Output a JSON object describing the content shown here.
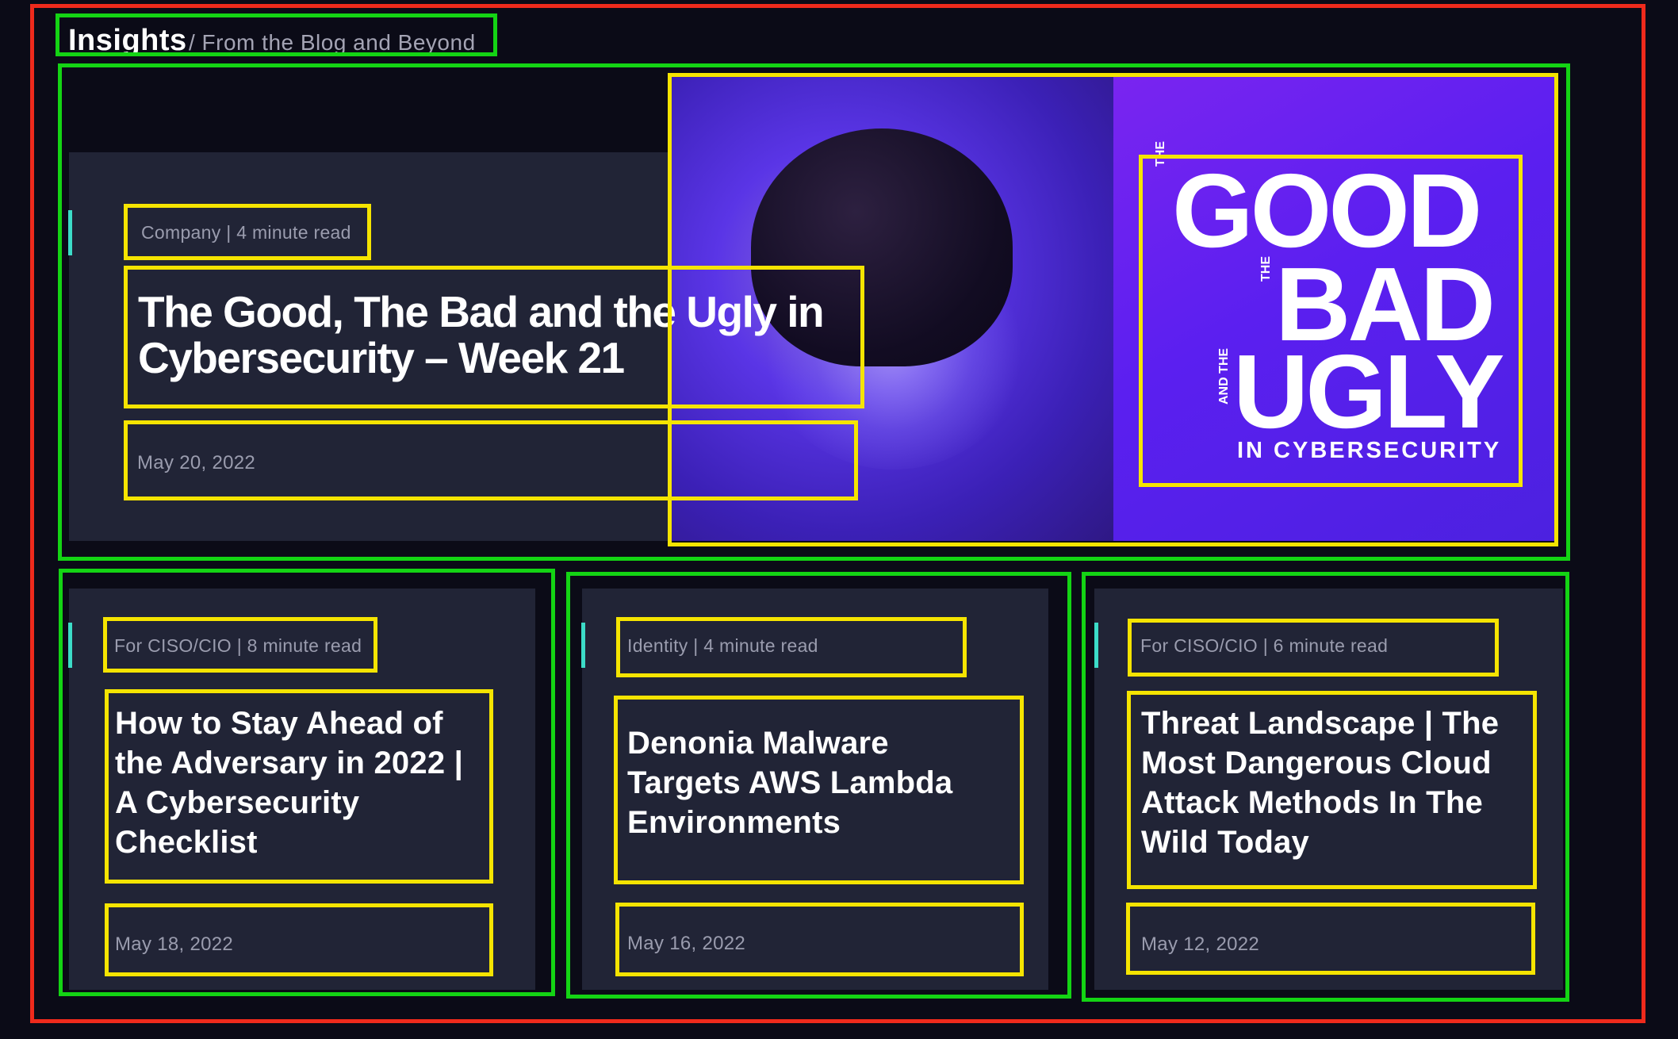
{
  "header": {
    "title": "Insights",
    "subtitle": "/ From the Blog and Beyond"
  },
  "featured": {
    "meta": "Company | 4 minute read",
    "title": "The Good, The Bad and the Ugly in Cybersecurity – Week 21",
    "date": "May 20, 2022",
    "image_logo": {
      "the_1": "THE",
      "good": "GOOD",
      "the_2": "THE",
      "bad": "BAD",
      "and_the": "AND THE",
      "ugly": "UGLY",
      "tagline": "IN CYBERSECURITY"
    }
  },
  "cards": [
    {
      "meta": "For CISO/CIO | 8 minute read",
      "title": "How to Stay Ahead of the Adversary in 2022 | A Cybersecurity Checklist",
      "date": "May 18, 2022"
    },
    {
      "meta": "Identity | 4 minute read",
      "title": "Denonia Malware Targets AWS Lambda Environments",
      "date": "May 16, 2022"
    },
    {
      "meta": "For CISO/CIO | 6 minute read",
      "title": "Threat Landscape | The Most Dangerous Cloud Attack Methods In The Wild Today",
      "date": "May 12, 2022"
    }
  ],
  "colors": {
    "background": "#0b0b17",
    "card": "#212436",
    "accent": "#3cdcc8",
    "annotation_outer": "#ef2a1c",
    "annotation_group": "#14d414",
    "annotation_item": "#f5e400"
  }
}
